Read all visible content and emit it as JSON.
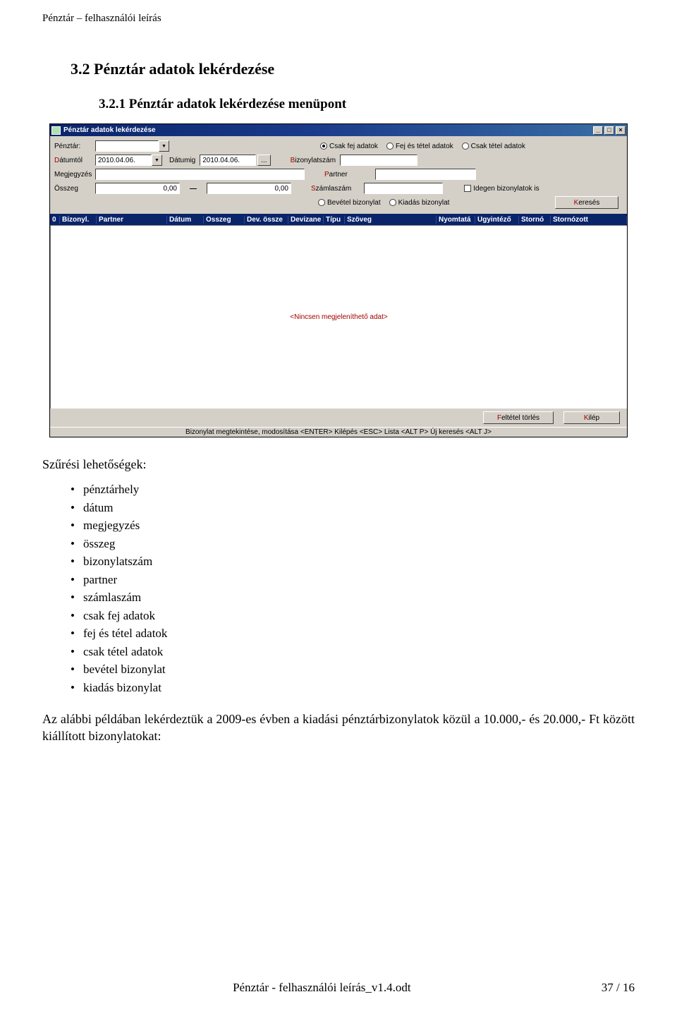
{
  "doc": {
    "header": "Pénztár – felhasználói leírás",
    "section_number_title": "3.2   Pénztár adatok lekérdezése",
    "subsection_number_title": "3.2.1   Pénztár adatok lekérdezése menüpont",
    "filter_heading": "Szűrési lehetőségek:",
    "bullets": [
      "pénztárhely",
      "dátum",
      "megjegyzés",
      "összeg",
      "bizonylatszám",
      "partner",
      "számlaszám",
      "csak fej adatok",
      "fej és tétel adatok",
      "csak tétel adatok",
      "bevétel bizonylat",
      "kiadás bizonylat"
    ],
    "paragraph": "Az alábbi példában lekérdeztük a 2009-es évben a kiadási pénztárbizonylatok közül a 10.000,- és 20.000,- Ft között kiállított bizonylatokat:",
    "footer_center": "Pénztár - felhasználói leírás_v1.4.odt",
    "footer_page": "37 / 16"
  },
  "app": {
    "title": "Pénztár adatok lekérdezése",
    "labels": {
      "penztar": "Pénztár:",
      "datumtol_pre": "D",
      "datumtol_rest": "átumtól",
      "datumig": "Dátumig",
      "megjegyzes": "Megjegyzés",
      "osszeg": "Összeg",
      "bizonylatszam_pre": "B",
      "bizonylatszam_rest": "izonylatszám",
      "partner_pre": "P",
      "partner_rest": "artner",
      "szamlaszam_pre": "S",
      "szamlaszam_rest": "zámlaszám",
      "idegen": "Idegen bizonylatok is",
      "kereses_pre": "K",
      "kereses_rest": "eresés",
      "feltetel_pre": "F",
      "feltetel_rest": "eltétel törlés",
      "kilep_pre": "K",
      "kilep_rest": "ilép",
      "dash": "—",
      "ellipsis": "..."
    },
    "values": {
      "datumtol": "2010.04.06.",
      "datumig": "2010.04.06.",
      "osszeg_from": "0,00",
      "osszeg_to": "0,00"
    },
    "radios_top": {
      "csak_fej": "Csak fej adatok",
      "fej_es_tetel": "Fej és tétel adatok",
      "csak_tetel": "Csak tétel adatok",
      "selected": "csak_fej"
    },
    "radios_bottom": {
      "bevetel": "Bevétel bizonylat",
      "kiadas": "Kiadás bizonylat"
    },
    "columns": [
      "0",
      "Bizonyl.",
      "Partner",
      "Dátum",
      "Összeg",
      "Dev. össze",
      "Devizane",
      "Típu",
      "Szöveg",
      "Nyomtatá",
      "Ügyintéző",
      "Stornó",
      "Stornózott"
    ],
    "empty_text": "<Nincsen megjeleníthető adat>",
    "status": "Bizonylat megtekintése, modosítása <ENTER>   Kilépés <ESC> Lista <ALT P> Új keresés <ALT J>"
  }
}
